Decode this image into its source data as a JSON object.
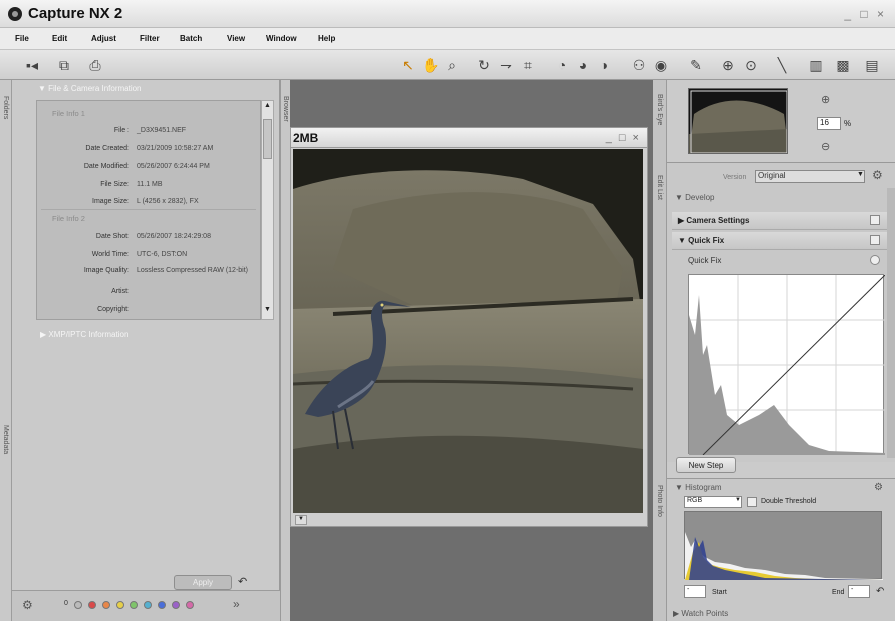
{
  "app": {
    "title": "Capture NX 2"
  },
  "window_controls": {
    "label": "_ □ ×"
  },
  "menu": [
    "File",
    "Edit",
    "Adjust",
    "Filter",
    "Batch",
    "View",
    "Window",
    "Help"
  ],
  "left_side_tabs": {
    "folders": "Folders",
    "metadata": "Metadata"
  },
  "browser_tab": "Browser",
  "file_info": {
    "section_title": "File & Camera Information",
    "group1_title": "File Info 1",
    "group1": [
      {
        "label": "File :",
        "value": "_D3X9451.NEF"
      },
      {
        "label": "Date Created:",
        "value": "03/21/2009 10:58:27 AM"
      },
      {
        "label": "Date Modified:",
        "value": "05/26/2007 6:24:44 PM"
      },
      {
        "label": "File Size:",
        "value": "11.1 MB"
      },
      {
        "label": "Image Size:",
        "value": "L (4256 x 2832), FX"
      }
    ],
    "group2_title": "File Info 2",
    "group2": [
      {
        "label": "Date Shot:",
        "value": "05/26/2007 18:24:29:08"
      },
      {
        "label": "World Time:",
        "value": "UTC-6, DST:ON"
      },
      {
        "label": "Image Quality:",
        "value": "Lossless Compressed RAW (12-bit)"
      },
      {
        "label": "Artist:",
        "value": ""
      },
      {
        "label": "Copyright:",
        "value": ""
      }
    ]
  },
  "xmp_section": "XMP/IPTC Information",
  "left_bottom": {
    "apply": "Apply",
    "more": "»",
    "zero": "0"
  },
  "image_window": {
    "title": "2MB",
    "controls": "_ □ ×"
  },
  "birds_eye": {
    "label": "Bird's Eye",
    "zoom_value": "16",
    "zoom_unit": "%"
  },
  "edit_list": {
    "label": "Edit List",
    "version_label": "Version",
    "version_value": "Original",
    "develop": "Develop",
    "camera_settings": "Camera Settings",
    "quick_fix": "Quick Fix",
    "quick_fix_item": "Quick Fix",
    "new_step": "New Step"
  },
  "photo_info": {
    "label": "Photo Info",
    "histogram_title": "Histogram",
    "channel": "RGB",
    "double_threshold": "Double Threshold",
    "start_label": "Start",
    "end_label": "End",
    "start_value": "-",
    "end_value": "-",
    "watch_points": "Watch Points"
  },
  "colors": {
    "accent": "#3c3c3c",
    "label_dots": [
      "#bbbbbb",
      "#d94a4a",
      "#e8874a",
      "#e6cf4a",
      "#7fc46a",
      "#56b0cf",
      "#4a6ed9",
      "#9a62c8",
      "#d46aa8"
    ]
  }
}
